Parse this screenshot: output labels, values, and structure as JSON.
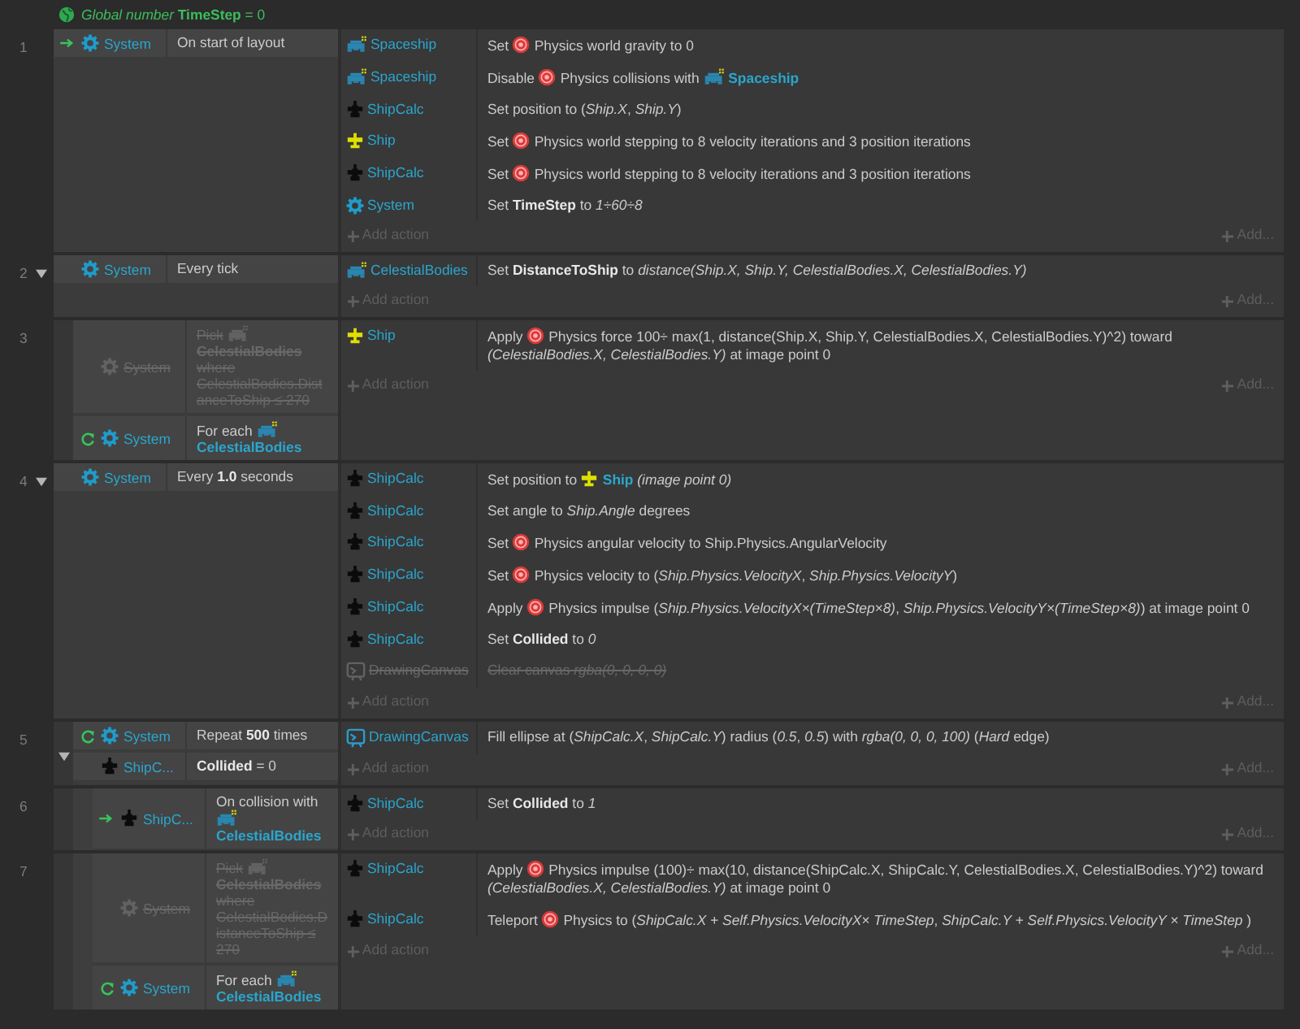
{
  "global_variable": "*Global number* **TimeStep** = 0",
  "events": [
    {
      "number": "1",
      "conditions": [
        {
          "kind": "trigger",
          "disabled": false,
          "object": {
            "kind": "system",
            "name": "System"
          },
          "parts": [
            "On start of layout"
          ]
        }
      ],
      "actions": [
        {
          "disabled": false,
          "object": {
            "kind": "invader",
            "name": "Spaceship"
          },
          "parts": [
            "Set",
            {
              "kind": "behavior"
            },
            "Physics world gravity to 0"
          ]
        },
        {
          "disabled": false,
          "object": {
            "kind": "invader",
            "name": "Spaceship"
          },
          "parts": [
            "Disable",
            {
              "kind": "behavior"
            },
            "Physics collisions with",
            {
              "kind": "invader",
              "name": "Spaceship"
            }
          ]
        },
        {
          "disabled": false,
          "object": {
            "kind": "calc",
            "name": "ShipCalc"
          },
          "parts": [
            "Set position to (*Ship.X*, *Ship.Y*)"
          ]
        },
        {
          "disabled": false,
          "object": {
            "kind": "ship",
            "name": "Ship"
          },
          "parts": [
            "Set",
            {
              "kind": "behavior"
            },
            "Physics world stepping to 8 velocity iterations and 3 position iterations"
          ]
        },
        {
          "disabled": false,
          "object": {
            "kind": "calc",
            "name": "ShipCalc"
          },
          "parts": [
            "Set",
            {
              "kind": "behavior"
            },
            "Physics world stepping to 8 velocity iterations and 3 position iterations"
          ]
        },
        {
          "disabled": false,
          "object": {
            "kind": "system",
            "name": "System"
          },
          "parts": [
            "Set **TimeStep** to *1÷60÷8*"
          ]
        }
      ],
      "add_action": "Add action",
      "add_more": "Add..."
    },
    {
      "number": "2",
      "expanded": true,
      "conditions": [
        {
          "kind": "plain",
          "disabled": false,
          "object": {
            "kind": "system",
            "name": "System"
          },
          "parts": [
            "Every tick"
          ]
        }
      ],
      "actions": [
        {
          "disabled": false,
          "object": {
            "kind": "invader",
            "name": "CelestialBodies"
          },
          "parts": [
            "Set **DistanceToShip** to *distance(Ship.X, Ship.Y, CelestialBodies.X, CelestialBodies.Y)*"
          ]
        }
      ],
      "add_action": "Add action",
      "add_more": "Add...",
      "children": [
        {
          "number": "3",
          "conditions": [
            {
              "kind": "plain",
              "disabled": true,
              "object": {
                "kind": "system",
                "name": "System"
              },
              "parts": [
                "Pick",
                {
                  "kind": "invader",
                  "name": "CelestialBodies"
                },
                "where CelestialBodies.DistanceToShip ≤ 270"
              ]
            },
            {
              "kind": "loop",
              "disabled": false,
              "object": {
                "kind": "system",
                "name": "System"
              },
              "parts": [
                "For each",
                {
                  "kind": "invader",
                  "name": "CelestialBodies"
                }
              ]
            }
          ],
          "actions": [
            {
              "disabled": false,
              "object": {
                "kind": "ship",
                "name": "Ship"
              },
              "parts": [
                "Apply",
                {
                  "kind": "behavior"
                },
                "Physics force 100÷ max(1, distance(Ship.X, Ship.Y, CelestialBodies.X, CelestialBodies.Y)^2) toward *(CelestialBodies.X, CelestialBodies.Y)* at image point 0"
              ]
            }
          ],
          "add_action": "Add action",
          "add_more": "Add..."
        }
      ]
    },
    {
      "number": "4",
      "expanded": true,
      "conditions": [
        {
          "kind": "plain",
          "disabled": false,
          "object": {
            "kind": "system",
            "name": "System"
          },
          "parts": [
            "Every **1.0** seconds"
          ]
        }
      ],
      "actions": [
        {
          "disabled": false,
          "object": {
            "kind": "calc",
            "name": "ShipCalc"
          },
          "parts": [
            "Set position to",
            {
              "kind": "ship",
              "name": "Ship"
            },
            "*(image point 0)*"
          ]
        },
        {
          "disabled": false,
          "object": {
            "kind": "calc",
            "name": "ShipCalc"
          },
          "parts": [
            "Set angle to *Ship.Angle* degrees"
          ]
        },
        {
          "disabled": false,
          "object": {
            "kind": "calc",
            "name": "ShipCalc"
          },
          "parts": [
            "Set",
            {
              "kind": "behavior"
            },
            "Physics angular velocity to Ship.Physics.AngularVelocity"
          ]
        },
        {
          "disabled": false,
          "object": {
            "kind": "calc",
            "name": "ShipCalc"
          },
          "parts": [
            "Set",
            {
              "kind": "behavior"
            },
            "Physics velocity to (*Ship.Physics.VelocityX*, *Ship.Physics.VelocityY*)"
          ]
        },
        {
          "disabled": false,
          "object": {
            "kind": "calc",
            "name": "ShipCalc"
          },
          "parts": [
            "Apply",
            {
              "kind": "behavior"
            },
            "Physics impulse (*Ship.Physics.VelocityX×(TimeStep×8)*, *Ship.Physics.VelocityY×(TimeStep×8)*) at image point 0"
          ]
        },
        {
          "disabled": false,
          "object": {
            "kind": "calc",
            "name": "ShipCalc"
          },
          "parts": [
            "Set **Collided** to *0*"
          ]
        },
        {
          "disabled": true,
          "object": {
            "kind": "canvas",
            "name": "DrawingCanvas"
          },
          "parts": [
            "Clear canvas *rgba(0, 0, 0, 0)*"
          ]
        }
      ],
      "add_action": "Add action",
      "add_more": "Add...",
      "children": [
        {
          "number": "5",
          "expanded": true,
          "conditions": [
            {
              "kind": "loop",
              "disabled": false,
              "object": {
                "kind": "system",
                "name": "System"
              },
              "parts": [
                "Repeat **500** times"
              ]
            },
            {
              "kind": "plain",
              "disabled": false,
              "object": {
                "kind": "calc",
                "name": "ShipC..."
              },
              "parts": [
                "**Collided** = 0"
              ]
            }
          ],
          "actions": [
            {
              "disabled": false,
              "object": {
                "kind": "canvas",
                "name": "DrawingCanvas"
              },
              "parts": [
                "Fill ellipse at (*ShipCalc.X*, *ShipCalc.Y*) radius (*0.5*, *0.5*) with *rgba(0, 0, 0, 100)* (*Hard* edge)"
              ]
            }
          ],
          "add_action": "Add action",
          "add_more": "Add...",
          "children": [
            {
              "number": "6",
              "conditions": [
                {
                  "kind": "trigger",
                  "disabled": false,
                  "object": {
                    "kind": "calc",
                    "name": "ShipC..."
                  },
                  "parts": [
                    "On collision with",
                    {
                      "kind": "invader",
                      "name": "CelestialBodies"
                    }
                  ]
                }
              ],
              "actions": [
                {
                  "disabled": false,
                  "object": {
                    "kind": "calc",
                    "name": "ShipCalc"
                  },
                  "parts": [
                    "Set **Collided** to *1*"
                  ]
                }
              ],
              "add_action": "Add action",
              "add_more": "Add..."
            },
            {
              "number": "7",
              "conditions": [
                {
                  "kind": "plain",
                  "disabled": true,
                  "object": {
                    "kind": "system",
                    "name": "System"
                  },
                  "parts": [
                    "Pick",
                    {
                      "kind": "invader",
                      "name": "CelestialBodies"
                    },
                    "where CelestialBodies.DistanceToShip ≤ 270"
                  ]
                },
                {
                  "kind": "loop",
                  "disabled": false,
                  "object": {
                    "kind": "system",
                    "name": "System"
                  },
                  "parts": [
                    "For each",
                    {
                      "kind": "invader",
                      "name": "CelestialBodies"
                    }
                  ]
                }
              ],
              "actions": [
                {
                  "disabled": false,
                  "object": {
                    "kind": "calc",
                    "name": "ShipCalc"
                  },
                  "parts": [
                    "Apply",
                    {
                      "kind": "behavior"
                    },
                    "Physics impulse (100)÷ max(10, distance(ShipCalc.X, ShipCalc.Y, CelestialBodies.X, CelestialBodies.Y)^2) toward *(CelestialBodies.X, CelestialBodies.Y)* at image point 0"
                  ]
                },
                {
                  "disabled": false,
                  "object": {
                    "kind": "calc",
                    "name": "ShipCalc"
                  },
                  "parts": [
                    "Teleport",
                    {
                      "kind": "behavior"
                    },
                    "Physics to (*ShipCalc.X + Self.Physics.VelocityX× TimeStep*, *ShipCalc.Y + Self.Physics.VelocityY × TimeStep* )"
                  ]
                }
              ],
              "add_action": "Add action",
              "add_more": "Add..."
            }
          ]
        }
      ]
    }
  ]
}
